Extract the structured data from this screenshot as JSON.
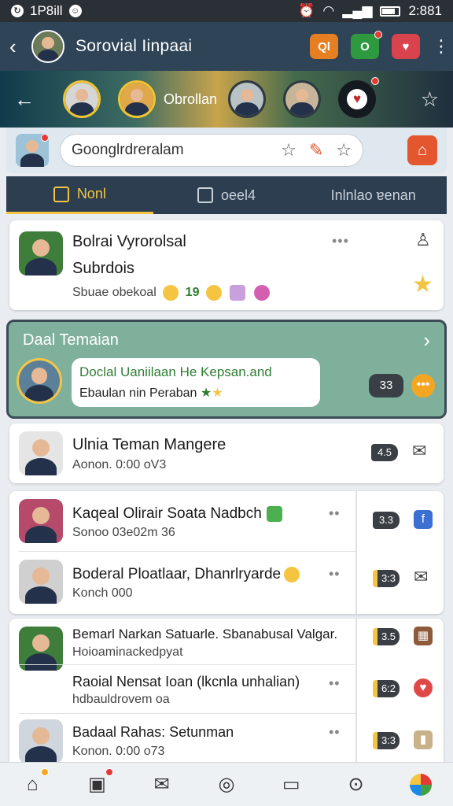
{
  "status_bar": {
    "left_text": "1P8ill",
    "time": "2:881"
  },
  "app_bar": {
    "title": "Sorovial Iinpaai",
    "buttons": [
      "Ql",
      "O",
      "♥"
    ]
  },
  "story_bar": {
    "label": "Obrollan"
  },
  "search": {
    "value": "Goonglrdreralam"
  },
  "tabs": [
    {
      "label": "Nonl",
      "active": true
    },
    {
      "label": "oeel4",
      "active": false
    },
    {
      "label": "Inlnlao ɐenan",
      "active": false
    }
  ],
  "top_card": {
    "title": "Bolrai Vyrorolsal",
    "subtitle": "Subrdois",
    "meta": "Sbuae obekoal",
    "meta_count": "19"
  },
  "featured": {
    "title": "Daal Temaian",
    "bubble_line1": "Doclal Uaniilaan He Kepsan.and",
    "bubble_line2": "Ebaulan nin Peraban",
    "count": "33"
  },
  "single_row": {
    "title": "Ulnia Teman Mangere",
    "subtitle": "Aonon. 0:00 oV3",
    "count": "4.5"
  },
  "list_group_1": [
    {
      "title": "Kaqeal Olirair Soata Nadbch",
      "subtitle": "Sonoo 03e02m 36",
      "count": "3.3"
    },
    {
      "title": "Boderal Ploatlaar, Dhanrlryarde",
      "subtitle": "Konch 000",
      "count": "3:3"
    }
  ],
  "list_group_2": [
    {
      "title": "Bemarl Narkan Satuarle. Sbanabusal Valgar.",
      "subtitle": "Hoioaminackedpyat",
      "count": "3.5"
    },
    {
      "title": "Raoial Nensat Ioan (lkcnla unhalian)",
      "subtitle": "hdbauldrovem oa",
      "count": "6:2"
    },
    {
      "title": "Badaal Rahas: Setunman",
      "subtitle": "Konon. 0:00 o73",
      "count": "3:3"
    }
  ],
  "bottom_nav": [
    "home-icon",
    "wallet-icon",
    "mail-icon",
    "compass-icon",
    "chat-icon",
    "location-icon",
    "globe-icon"
  ],
  "colors": {
    "app_bar": "#2f4457",
    "tab_active": "#f4c542",
    "featured_bg": "#7fb09c",
    "accent_orange": "#e4572e"
  }
}
